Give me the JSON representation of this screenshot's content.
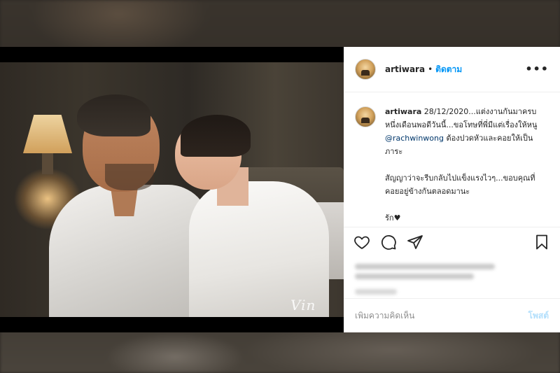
{
  "post": {
    "username": "artiwara",
    "separator": "•",
    "follow_label": "ติดตาม",
    "more_icon": "more-icon",
    "caption": {
      "username": "artiwara",
      "line1": " 28/12/2020...แต่งงานกันมาครบหนึ่งเดือนพอดีวันนี้...ขอโทษที่พี่มีแต่เรื่องให้หนู ",
      "mention": "@rachwinwong",
      "line1_end": " ต้องปวดหัวและคอยให้เป็นภาระ",
      "para2": "สัญญาว่าจะรีบกลับไปแข็งแรงไวๆ...ขอบคุณที่คอยอยู่ข้างกันตลอดมานะ",
      "para3": "รัก♥",
      "para4": "."
    },
    "photo_signature": "Vin"
  },
  "actions": {
    "like_icon": "heart-icon",
    "comment_icon": "comment-icon",
    "share_icon": "share-icon",
    "save_icon": "bookmark-icon"
  },
  "comment_bar": {
    "placeholder": "เพิ่มความคิดเห็น",
    "post_label": "โพสต์"
  },
  "colors": {
    "accent": "#0095f6",
    "mention": "#00376b",
    "post_disabled": "#b2dffc"
  }
}
